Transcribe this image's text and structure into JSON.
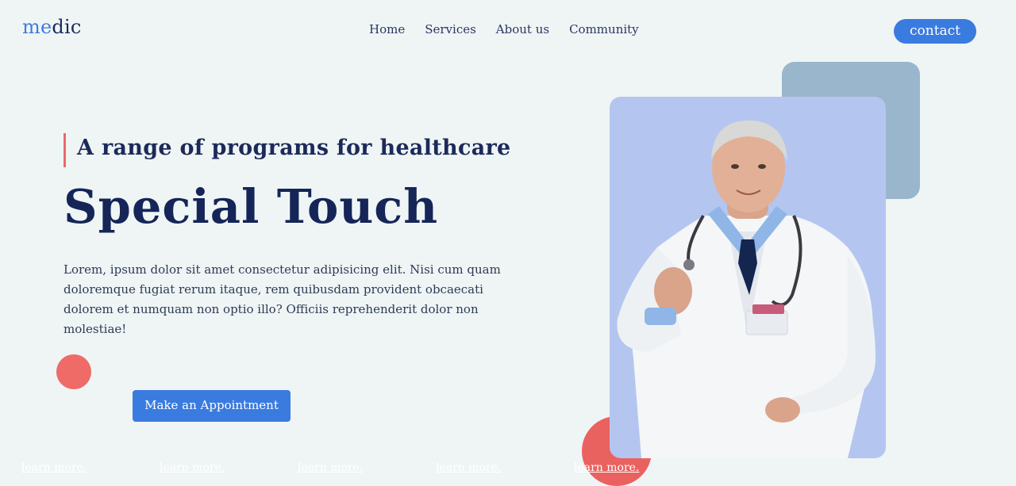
{
  "brand": {
    "logo_accent": "me",
    "logo_rest": "dic"
  },
  "nav": {
    "items": [
      "Home",
      "Services",
      "About us",
      "Community"
    ]
  },
  "header": {
    "contact_label": "contact"
  },
  "hero": {
    "tagline": "A range of programs for healthcare",
    "headline": "Special Touch",
    "body": "Lorem, ipsum dolor sit amet consectetur adipisicing elit. Nisi cum quam doloremque fugiat rerum itaque, rem quibusdam provident obcaecati dolorem et numquam non optio illo? Officiis reprehenderit dolor non molestiae!",
    "cta_label": "Make an Appointment"
  },
  "learn_more": [
    "learn more.",
    "learn more.",
    "learn more.",
    "learn more.",
    "learn more."
  ],
  "colors": {
    "accent": "#3a7be0",
    "coral": "#ee6b68",
    "navy": "#152558",
    "background": "#eff5f5",
    "card": "#b4c6f0",
    "card_back": "#9ab6cd"
  },
  "icons": {
    "hero_image": "doctor-photo"
  }
}
